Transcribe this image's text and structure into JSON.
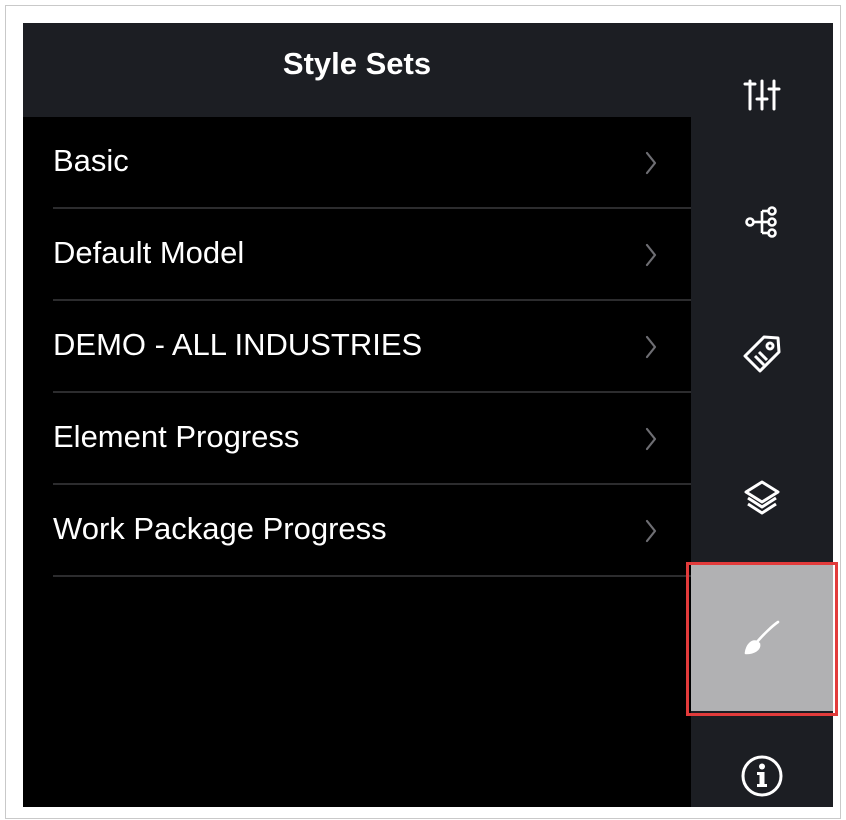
{
  "panel": {
    "title": "Style Sets",
    "items": [
      {
        "label": "Basic"
      },
      {
        "label": "Default Model"
      },
      {
        "label": "DEMO - ALL INDUSTRIES"
      },
      {
        "label": "Element Progress"
      },
      {
        "label": "Work Package Progress"
      }
    ]
  },
  "rail": {
    "buttons": [
      {
        "icon": "sliders-icon",
        "active": false
      },
      {
        "icon": "hierarchy-icon",
        "active": false
      },
      {
        "icon": "tag-icon",
        "active": false
      },
      {
        "icon": "layers-icon",
        "active": false
      },
      {
        "icon": "paintbrush-icon",
        "active": true
      },
      {
        "icon": "info-icon",
        "active": false
      }
    ]
  },
  "colors": {
    "background": "#000000",
    "header": "#1c1e23",
    "rail": "#1c1e23",
    "active_button": "#b1b1b3",
    "highlight": "#e23b3b",
    "text": "#ffffff",
    "chevron": "#6e6e73"
  }
}
